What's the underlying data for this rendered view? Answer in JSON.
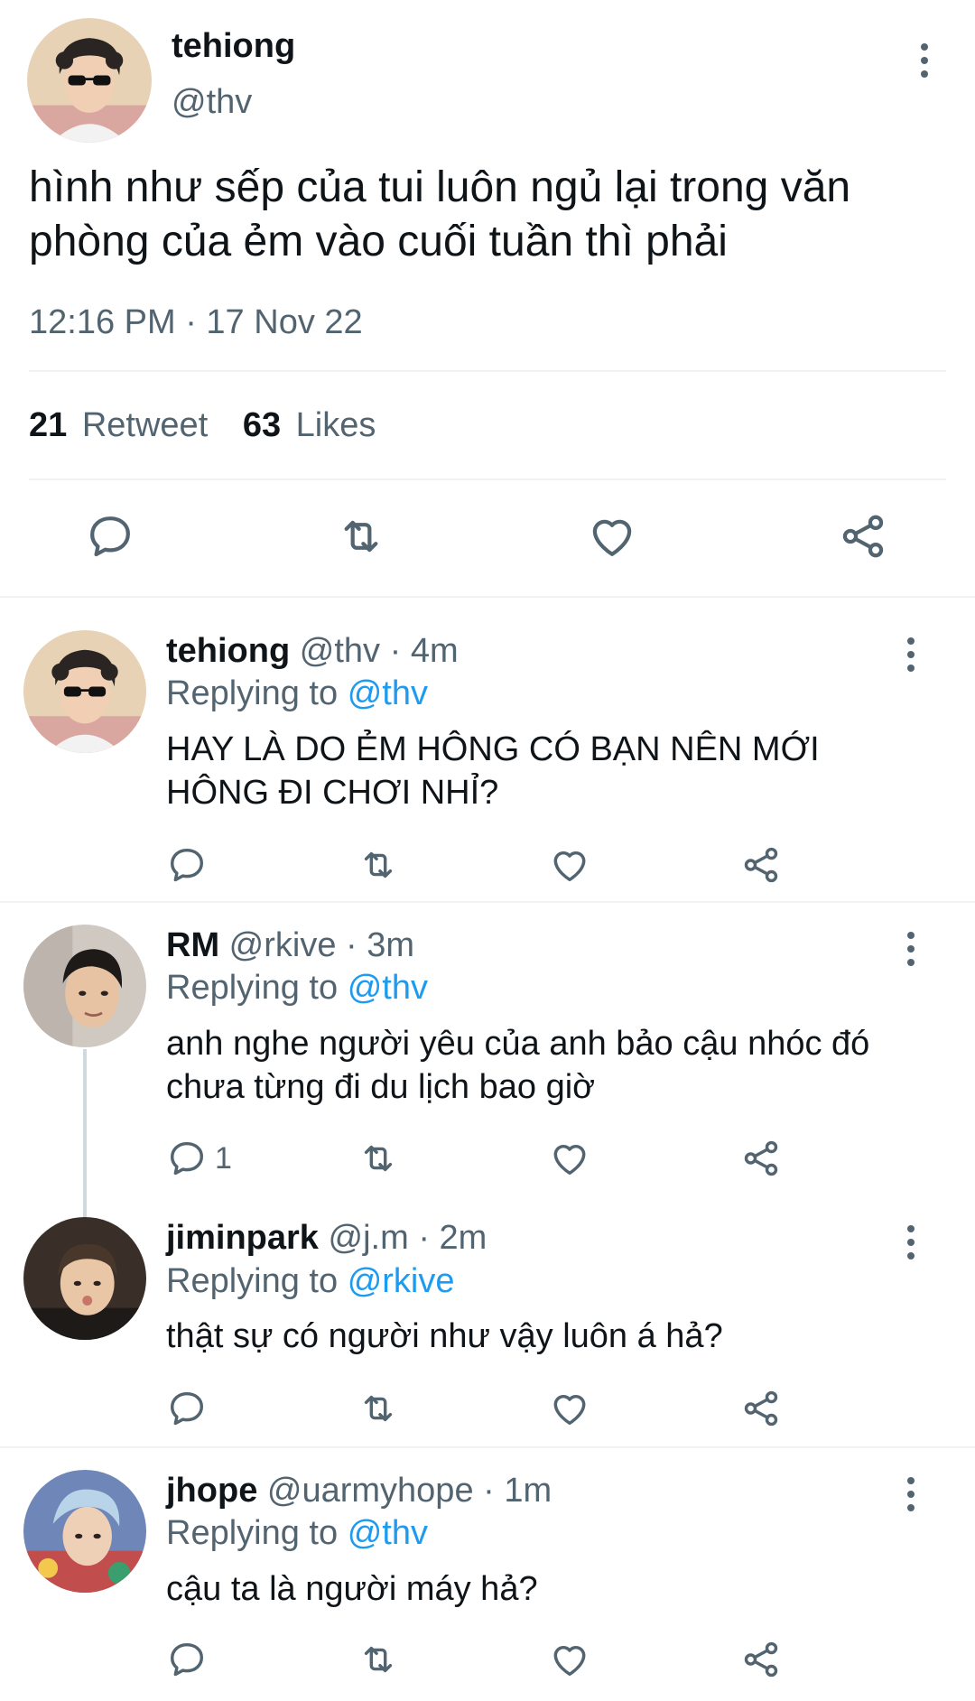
{
  "main_tweet": {
    "display_name": "tehiong",
    "handle": "@thv",
    "text": "hình như sếp của tui luôn ngủ lại trong văn phòng của ẻm vào cuối tuần thì phải",
    "timestamp": "12:16 PM · 17 Nov 22",
    "retweet_count": "21",
    "retweet_label": "Retweet",
    "like_count": "63",
    "like_label": "Likes",
    "avatar_icon": "avatar-curly-hair-sunglasses"
  },
  "action_icons": [
    "reply-icon",
    "retweet-icon",
    "like-icon",
    "share-icon"
  ],
  "replies": [
    {
      "display_name": "tehiong",
      "handle": "@thv",
      "time": "· 4m",
      "replying_label": "Replying to",
      "replying_to": "@thv",
      "text": "HAY LÀ DO ẺM HÔNG CÓ BẠN NÊN MỚI HÔNG ĐI CHƠI NHỈ?",
      "reply_count": ""
    },
    {
      "display_name": "RM",
      "handle": "@rkive",
      "time": "· 3m",
      "replying_label": "Replying to",
      "replying_to": "@thv",
      "text": "anh nghe người yêu của anh bảo cậu nhóc đó chưa từng đi du lịch bao giờ",
      "reply_count": "1"
    },
    {
      "display_name": "jiminpark",
      "handle": "@j.m",
      "time": "· 2m",
      "replying_label": "Replying to",
      "replying_to": "@rkive",
      "text": "thật sự có người như vậy luôn á hả?",
      "reply_count": ""
    },
    {
      "display_name": "jhope",
      "handle": "@uarmyhope",
      "time": "· 1m",
      "replying_label": "Replying to",
      "replying_to": "@thv",
      "text": "cậu ta là người máy hả?",
      "reply_count": ""
    }
  ],
  "colors": {
    "text": "#0f1419",
    "secondary": "#536471",
    "link": "#1d9bf0",
    "divider": "#eff3f4"
  }
}
